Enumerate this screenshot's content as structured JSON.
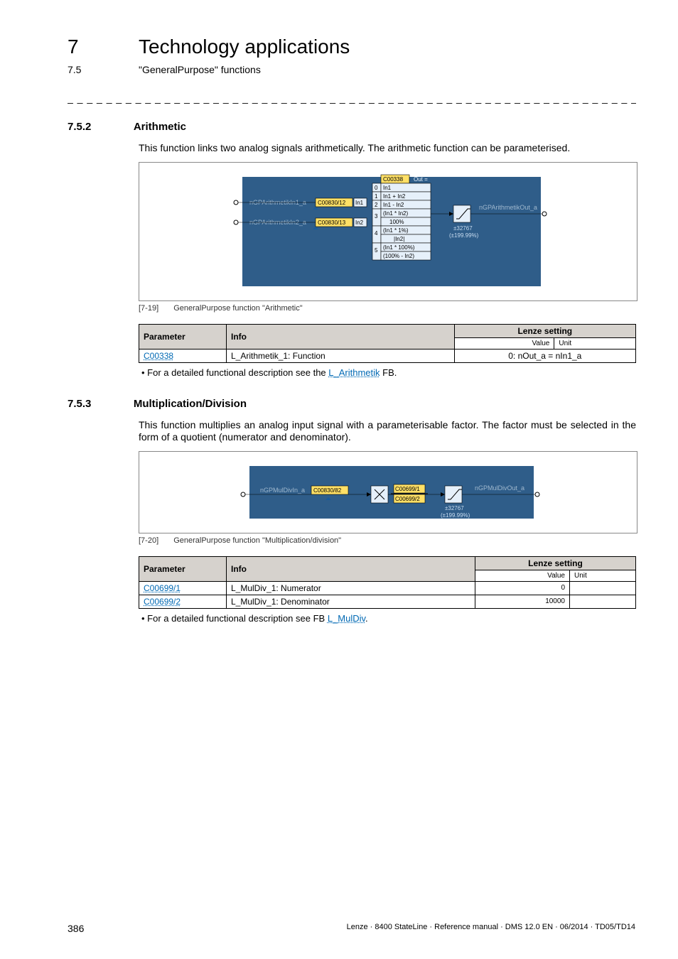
{
  "header": {
    "chapter_num": "7",
    "chapter_title": "Technology applications",
    "section_num": "7.5",
    "section_title": "\"GeneralPurpose\" functions",
    "dash_rule": "_ _ _ _ _ _ _ _ _ _ _ _ _ _ _ _ _ _ _ _ _ _ _ _ _ _ _ _ _ _ _ _ _ _ _ _ _ _ _ _ _ _ _ _ _ _ _ _ _ _ _ _ _ _ _ _ _ _ _ _ _ _ _ _"
  },
  "sec_a": {
    "num": "7.5.2",
    "title": "Arithmetic",
    "para": "This function links two analog signals arithmetically. The arithmetic function can be parameterised.",
    "caption_label": "[7-19]",
    "caption_text": "GeneralPurpose function \"Arithmetic\"",
    "table": {
      "h_param": "Parameter",
      "h_info": "Info",
      "h_lenze": "Lenze setting",
      "h_value": "Value",
      "h_unit": "Unit",
      "row1": {
        "param": "C00338",
        "info": "L_Arithmetik_1: Function",
        "value_unit": "0: nOut_a = nIn1_a"
      }
    },
    "bullet_pre": "For a detailed functional description see the ",
    "bullet_link": "L_Arithmetik",
    "bullet_post": " FB.",
    "diag": {
      "in1_signal": "nGPArithmetikIn1_a",
      "in1_code": "C00830/12",
      "in1_port": "In1",
      "in2_signal": "nGPArithmetikIn2_a",
      "in2_code": "C00830/13",
      "in2_port": "In2",
      "out_code": "C00338",
      "out_label": "Out =",
      "opts": [
        "In1",
        "In1 + In2",
        "In1 - In2",
        "(In1 * In2)",
        "100%",
        "(In1 * 1%)",
        "|In2|",
        "(In1 * 100%)",
        "(100% - In2)"
      ],
      "idx": [
        "0",
        "1",
        "2",
        "3",
        "4",
        "5"
      ],
      "out_signal": "nGPArithmetikOut_a",
      "limit1": "±32767",
      "limit2": "(±199.99%)"
    }
  },
  "sec_b": {
    "num": "7.5.3",
    "title": "Multiplication/Division",
    "para": "This function multiplies an analog input signal with a parameterisable factor. The factor must be selected in the form of a quotient (numerator and denominator).",
    "caption_label": "[7-20]",
    "caption_text": "GeneralPurpose function \"Multiplication/division\"",
    "table": {
      "h_param": "Parameter",
      "h_info": "Info",
      "h_lenze": "Lenze setting",
      "h_value": "Value",
      "h_unit": "Unit",
      "rows": [
        {
          "param": "C00699/1",
          "info": "L_MulDiv_1: Numerator",
          "value": "0",
          "unit": ""
        },
        {
          "param": "C00699/2",
          "info": "L_MulDiv_1: Denominator",
          "value": "10000",
          "unit": ""
        }
      ]
    },
    "bullet_pre": "For a detailed functional description see FB ",
    "bullet_link": "L_MulDiv",
    "bullet_post": ".",
    "diag": {
      "in_signal": "nGPMulDivIn_a",
      "in_code": "C00830/82",
      "num_code": "C00699/1",
      "den_code": "C00699/2",
      "out_signal": "nGPMulDivOut_a",
      "limit1": "±32767",
      "limit2": "(±199.99%)"
    }
  },
  "footer": {
    "page": "386",
    "text": "Lenze · 8400 StateLine · Reference manual · DMS 12.0 EN · 06/2014 · TD05/TD14"
  }
}
